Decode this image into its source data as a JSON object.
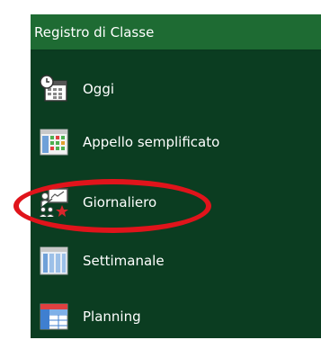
{
  "header": {
    "title": "Registro di Classe"
  },
  "menu": {
    "items": [
      {
        "label": "Oggi",
        "icon": "calendar-clock-icon"
      },
      {
        "label": "Appello semplificato",
        "icon": "attendance-grid-icon"
      },
      {
        "label": "Giornaliero",
        "icon": "teacher-board-icon"
      },
      {
        "label": "Settimanale",
        "icon": "weekly-columns-icon"
      },
      {
        "label": "Planning",
        "icon": "planning-table-icon"
      }
    ]
  },
  "annotation": {
    "color": "#e0141b",
    "target": "Giornaliero"
  },
  "colors": {
    "panel": "#0b3d21",
    "header": "#1e6b33",
    "text": "#ffffff"
  }
}
